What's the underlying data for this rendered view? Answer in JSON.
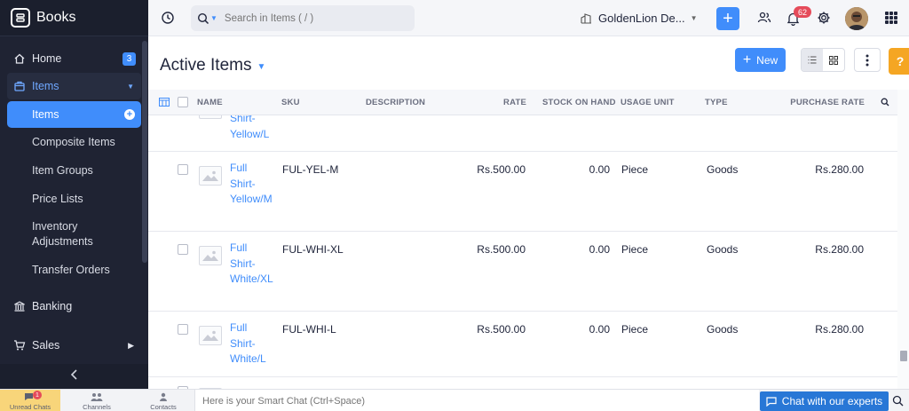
{
  "brand": {
    "name": "Books"
  },
  "sidebar": {
    "home": {
      "label": "Home",
      "badge": "3"
    },
    "items_group": {
      "label": "Items"
    },
    "sub_items": [
      {
        "label": "Items"
      },
      {
        "label": "Composite Items"
      },
      {
        "label": "Item Groups"
      },
      {
        "label": "Price Lists"
      },
      {
        "label": "Inventory Adjustments"
      },
      {
        "label": "Transfer Orders"
      }
    ],
    "banking": {
      "label": "Banking"
    },
    "sales": {
      "label": "Sales"
    }
  },
  "topbar": {
    "search_placeholder": "Search in Items ( / )",
    "org_name": "GoldenLion De...",
    "notification_count": "62"
  },
  "page": {
    "title": "Active Items",
    "new_label": "New",
    "help_label": "?"
  },
  "table": {
    "columns": {
      "name": "NAME",
      "sku": "SKU",
      "description": "DESCRIPTION",
      "rate": "RATE",
      "stock_on_hand": "STOCK ON HAND",
      "usage_unit": "USAGE UNIT",
      "type": "TYPE",
      "purchase_rate": "PURCHASE RATE"
    },
    "partial_top_name": "Shirt-\nYellow/L",
    "rows": [
      {
        "name": "Full Shirt-Yellow/M",
        "sku": "FUL-YEL-M",
        "rate": "Rs.500.00",
        "stock": "0.00",
        "unit": "Piece",
        "type": "Goods",
        "purchase_rate": "Rs.280.00"
      },
      {
        "name": "Full Shirt-White/XL",
        "sku": "FUL-WHI-XL",
        "rate": "Rs.500.00",
        "stock": "0.00",
        "unit": "Piece",
        "type": "Goods",
        "purchase_rate": "Rs.280.00"
      },
      {
        "name": "Full Shirt-White/L",
        "sku": "FUL-WHI-L",
        "rate": "Rs.500.00",
        "stock": "0.00",
        "unit": "Piece",
        "type": "Goods",
        "purchase_rate": "Rs.280.00"
      }
    ]
  },
  "bottombar": {
    "unread_chats": "Unread Chats",
    "unread_count": "1",
    "channels": "Channels",
    "contacts": "Contacts",
    "smart_chat_placeholder": "Here is your Smart Chat (Ctrl+Space)",
    "chat_experts": "Chat with our experts"
  }
}
